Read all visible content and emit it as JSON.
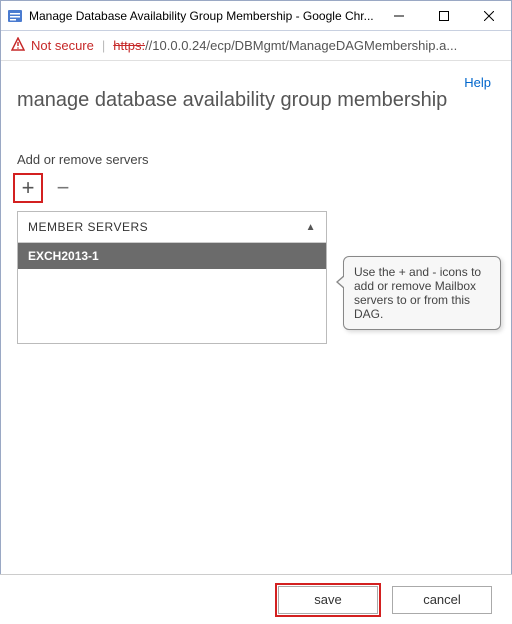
{
  "window": {
    "title": "Manage Database Availability Group Membership - Google Chr..."
  },
  "addressbar": {
    "not_secure": "Not secure",
    "https": "https:",
    "url_rest": "//10.0.0.24/ecp/DBMgmt/ManageDAGMembership.a..."
  },
  "help": {
    "label": "Help"
  },
  "page": {
    "heading": "manage database availability group membership"
  },
  "section": {
    "label": "Add or remove servers"
  },
  "toolbar": {
    "plus": "+",
    "minus": "−"
  },
  "list": {
    "header": "MEMBER SERVERS",
    "sort_icon": "▲",
    "rows": [
      "EXCH2013-1"
    ]
  },
  "callout": {
    "text": "Use the + and - icons to add or remove Mailbox servers to or from this DAG."
  },
  "footer": {
    "save": "save",
    "cancel": "cancel"
  }
}
